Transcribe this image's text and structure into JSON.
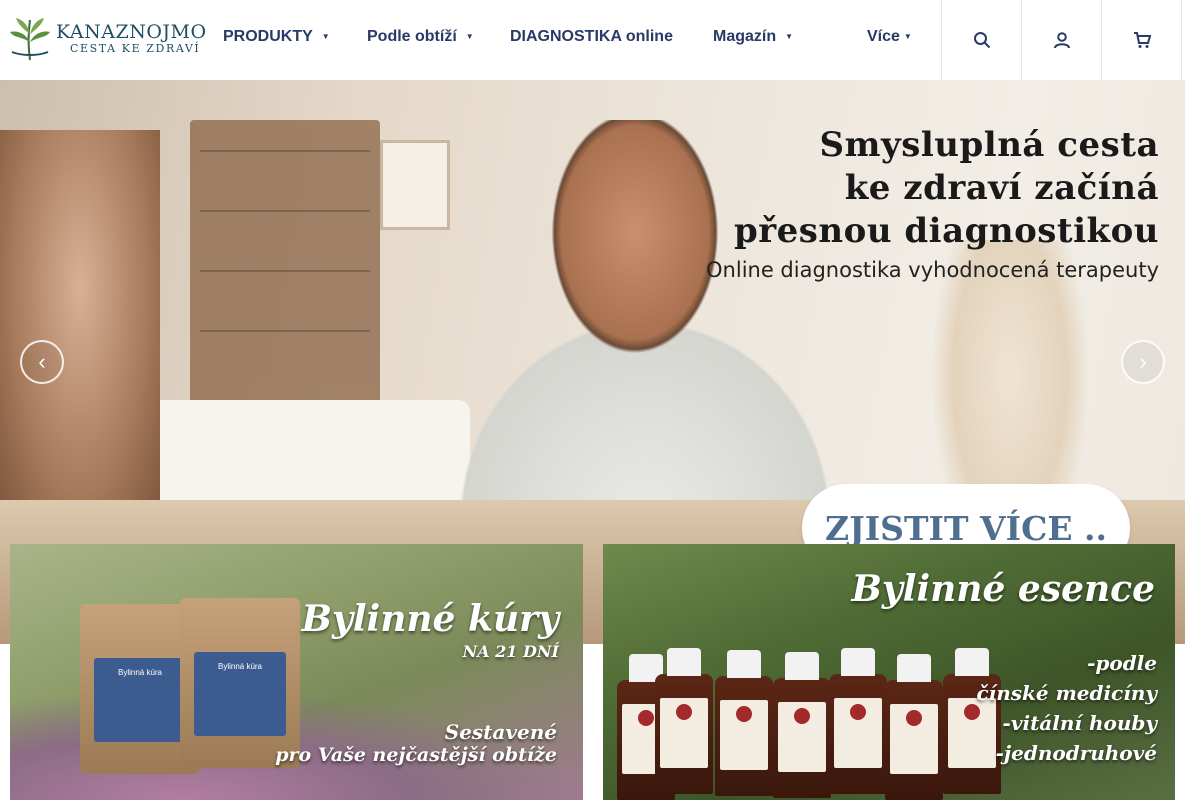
{
  "brand": {
    "name": "KANAZNOJMO",
    "tagline": "CESTA KE ZDRAVÍ"
  },
  "nav": {
    "items": [
      {
        "label": "PRODUKTY",
        "has_dropdown": true
      },
      {
        "label": "Podle obtíží",
        "has_dropdown": true
      },
      {
        "label": "DIAGNOSTIKA online",
        "has_dropdown": false
      },
      {
        "label": "Magazín",
        "has_dropdown": true
      },
      {
        "label": "Více",
        "has_dropdown": true
      }
    ],
    "caret_icon": "chevron-down-icon"
  },
  "header_icons": [
    "search-icon",
    "user-icon",
    "cart-icon"
  ],
  "hero": {
    "headline_line1": "Smysluplná cesta",
    "headline_line2": "ke zdraví začíná",
    "headline_line3": "přesnou diagnostikou",
    "subheadline": "Online diagnostika vyhodnocená terapeuty",
    "cta_label": "ZJISTIT VÍCE ..",
    "prev_icon": "arrow-left-icon",
    "next_icon": "arrow-right-icon"
  },
  "banners": {
    "kury": {
      "title": "Bylinné kúry",
      "subtitle": "NA 21 DNÍ",
      "note_line1": "Sestavené",
      "note_line2": "pro Vaše nejčastější obtíže",
      "bag_label_1": "Bylinná kúra",
      "bag_label_2": "Bylinná kúra"
    },
    "esence": {
      "title": "Bylinné esence",
      "tag1": "-podle",
      "tag2": "čínské medicíny",
      "tag3": "-vitální houby",
      "tag4": "-jednodruhové"
    }
  },
  "colors": {
    "nav_text": "#2a3a66",
    "cta_text": "#4f6e90",
    "brand": "#1f4e63"
  }
}
